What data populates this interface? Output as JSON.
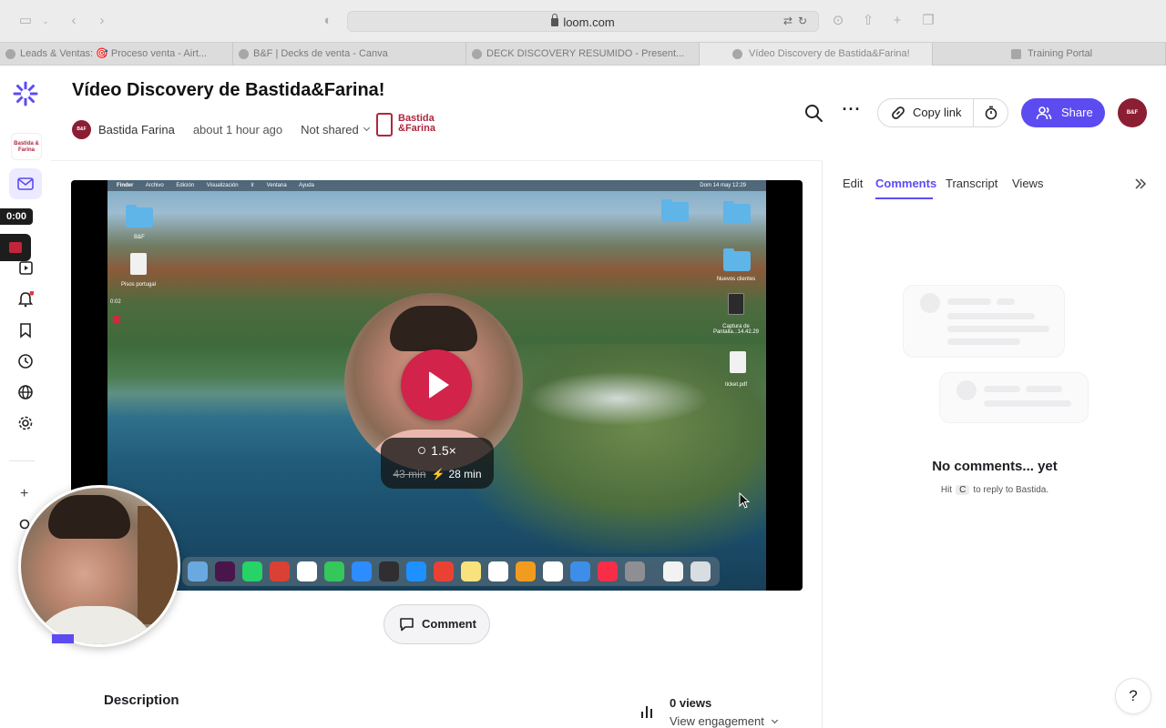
{
  "browser": {
    "url": "loom.com",
    "tabs": [
      {
        "label": "Leads & Ventas: 🎯 Proceso venta - Airt...",
        "active": false
      },
      {
        "label": "B&F | Decks de venta - Canva",
        "active": false
      },
      {
        "label": "DECK DISCOVERY RESUMIDO - Present...",
        "active": false
      },
      {
        "label": "Vídeo Discovery de Bastida&Farina!",
        "active": true
      },
      {
        "label": "Training Portal",
        "active": false
      }
    ]
  },
  "rail": {
    "workspace_label": "Bastida & Farina",
    "recording_time": "0:00"
  },
  "header": {
    "title": "Vídeo Discovery de Bastida&Farina!",
    "author": "Bastida Farina",
    "time": "about 1 hour ago",
    "sharing": "Not shared",
    "brand_line1": "Bastida",
    "brand_line2": "&Farina",
    "copy_link_label": "Copy link",
    "share_label": "Share",
    "avatar_text": "B&F"
  },
  "video": {
    "menubar": [
      "Finder",
      "Archivo",
      "Edición",
      "Visualización",
      "Ir",
      "Ventana",
      "Ayuda"
    ],
    "clock": "Dom 14 may 12:29",
    "desktop_labels": [
      "B&F",
      "Pisos portugal",
      "Nuevos clientes",
      "Captura de Pantalla...14.42.29",
      "ticket.pdf"
    ],
    "inner_timer": "0:02",
    "speed": "1.5×",
    "original_duration": "43 min",
    "fast_duration": "28 min"
  },
  "below": {
    "comment_label": "Comment",
    "description_title": "Description",
    "views_count": "0 views",
    "view_engagement": "View engagement"
  },
  "panel": {
    "tabs": [
      "Edit",
      "Comments",
      "Transcript",
      "Views"
    ],
    "active_tab": "Comments",
    "empty_title": "No comments... yet",
    "hint_prefix": "Hit",
    "hint_key": "C",
    "hint_suffix": "to reply to Bastida.",
    "help_label": "?"
  },
  "colors": {
    "accent": "#5d4bf2",
    "play": "#d2234a",
    "brand": "#b0263f"
  }
}
